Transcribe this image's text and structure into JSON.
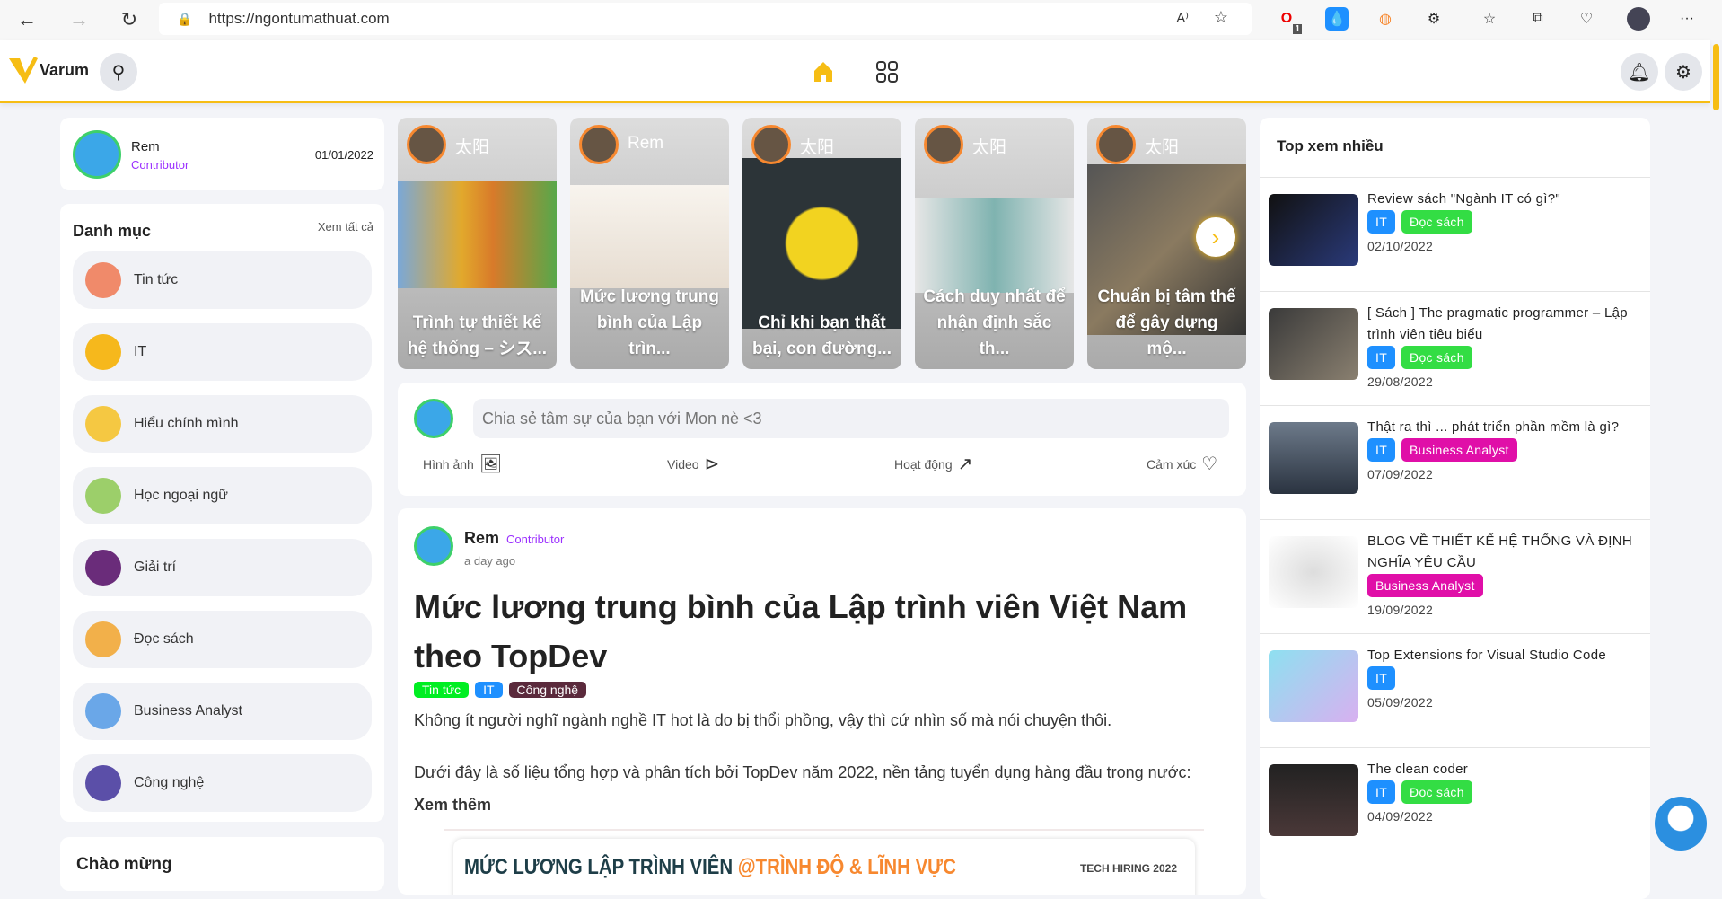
{
  "browser": {
    "url": "https://ngontumathuat.com",
    "ext_badge": "1"
  },
  "header": {
    "logo": "Varum"
  },
  "profile": {
    "name": "Rem",
    "role": "Contributor",
    "date": "01/01/2022"
  },
  "categories": {
    "title": "Danh mục",
    "see_all": "Xem tất cả",
    "items": [
      {
        "label": "Tin tức",
        "color": "#f08a6a"
      },
      {
        "label": "IT",
        "color": "#f6b81c"
      },
      {
        "label": "Hiểu chính mình",
        "color": "#f5c842"
      },
      {
        "label": "Học ngoại ngữ",
        "color": "#9ccf6a"
      },
      {
        "label": "Giải trí",
        "color": "#6a2c7a"
      },
      {
        "label": "Đọc sách",
        "color": "#f2b04a"
      },
      {
        "label": "Business Analyst",
        "color": "#6aa7e8"
      },
      {
        "label": "Công nghệ",
        "color": "#5b4fa8"
      }
    ]
  },
  "welcome": {
    "title": "Chào mừng"
  },
  "stories": [
    {
      "author": "太阳",
      "title": "Trình tự thiết kế hệ thống – シス..."
    },
    {
      "author": "Rem",
      "title": "Mức lương trung bình của Lập trìn..."
    },
    {
      "author": "太阳",
      "title": "Chỉ khi bạn thất bại, con đường..."
    },
    {
      "author": "太阳",
      "title": "Cách duy nhất để nhận định sắc th..."
    },
    {
      "author": "太阳",
      "title": "Chuẩn bị tâm thế để gây dựng mộ..."
    }
  ],
  "composer": {
    "placeholder": "Chia sẻ tâm sự của bạn với Mon nè <3",
    "actions": [
      "Hình ảnh",
      "Video",
      "Hoạt động",
      "Cảm xúc"
    ]
  },
  "post": {
    "author": "Rem",
    "role": "Contributor",
    "time": "a day ago",
    "title": "Mức lương trung bình của Lập trình viên Việt Nam theo TopDev",
    "tags": [
      "Tin tức",
      "IT",
      "Công nghệ"
    ],
    "p1": "Không ít người nghĩ ngành nghề IT hot là do bị thổi phồng, vậy thì cứ nhìn số mà nói chuyện thôi.",
    "p2": "Dưới đây là số liệu tổng hợp và phân tích bởi TopDev năm 2022, nền tảng tuyển dụng hàng đầu trong nước:",
    "more": "Xem thêm",
    "banner_a": "MỨC LƯƠNG LẬP TRÌNH VIÊN ",
    "banner_b": "@TRÌNH ĐỘ & LĨNH VỰC",
    "banner_c": "TECH HIRING 2022"
  },
  "top": {
    "title": "Top xem nhiều",
    "items": [
      {
        "title": "Review sách \"Ngành IT có gì?\"",
        "tags": [
          "IT",
          "Đọc sách"
        ],
        "date": "02/10/2022"
      },
      {
        "title": "[ Sách ] The pragmatic programmer – Lập trình viên tiêu biểu",
        "tags": [
          "IT",
          "Đọc sách"
        ],
        "date": "29/08/2022"
      },
      {
        "title": "Thật ra thì ... phát triển phần mềm là gì?",
        "tags": [
          "IT",
          "Business Analyst"
        ],
        "date": "07/09/2022"
      },
      {
        "title": "BLOG VỀ THIẾT KẾ HỆ THỐNG VÀ ĐỊNH NGHĨA YÊU CẦU",
        "tags": [
          "Business Analyst"
        ],
        "date": "19/09/2022"
      },
      {
        "title": "Top Extensions for Visual Studio Code",
        "tags": [
          "IT"
        ],
        "date": "05/09/2022"
      },
      {
        "title": "The clean coder",
        "tags": [
          "IT",
          "Đọc sách"
        ],
        "date": "04/09/2022"
      }
    ]
  }
}
